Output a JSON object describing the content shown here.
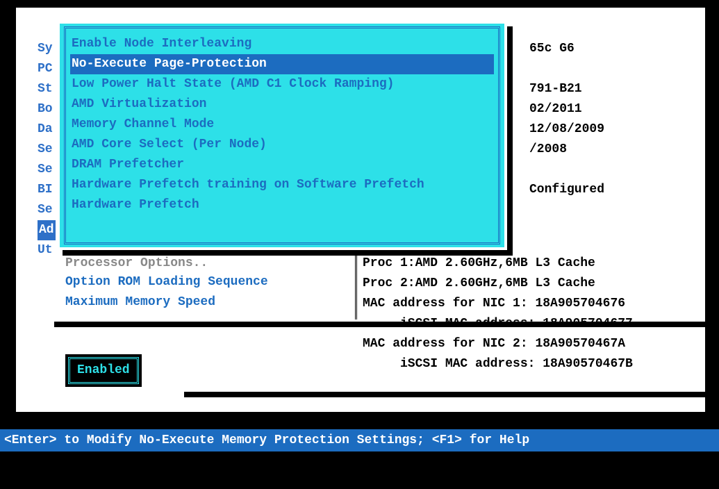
{
  "left_labels": [
    "Sy",
    "PC",
    "St",
    "Bo",
    "Da",
    "Se",
    "Se",
    "BI",
    "Se",
    "Ad",
    "Ut"
  ],
  "left_highlight_index": 9,
  "popup_menu": {
    "items": [
      "Enable Node Interleaving",
      "No-Execute Page-Protection",
      "Low Power Halt State (AMD C1 Clock Ramping)",
      "AMD Virtualization",
      "Memory Channel Mode",
      "AMD Core Select (Per Node)",
      "DRAM Prefetcher",
      "Hardware Prefetch training on Software Prefetch",
      "Hardware Prefetch"
    ],
    "selected_index": 1
  },
  "submenu": {
    "dim": "Processor Options..",
    "items": [
      "Option ROM Loading Sequence",
      "Maximum Memory Speed"
    ]
  },
  "right_info": {
    "l0": "65c G6",
    "l1": "",
    "l2": "791-B21",
    "l3": "02/2011",
    "l4": "12/08/2009",
    "l5": "/2008",
    "l6": "",
    "l7": "Configured"
  },
  "bottom_info": {
    "l0": "Proc 1:AMD 2.60GHz,6MB L3 Cache",
    "l1": "Proc 2:AMD 2.60GHz,6MB L3 Cache",
    "l2": "MAC address for NIC 1: 18A905704676",
    "l3": "     iSCSI MAC address: 18A905704677",
    "l4": "MAC address for NIC 2: 18A90570467A",
    "l5": "     iSCSI MAC address: 18A90570467B"
  },
  "value_box": "Enabled",
  "help_bar": "<Enter> to Modify No-Execute Memory Protection Settings; <F1> for Help"
}
